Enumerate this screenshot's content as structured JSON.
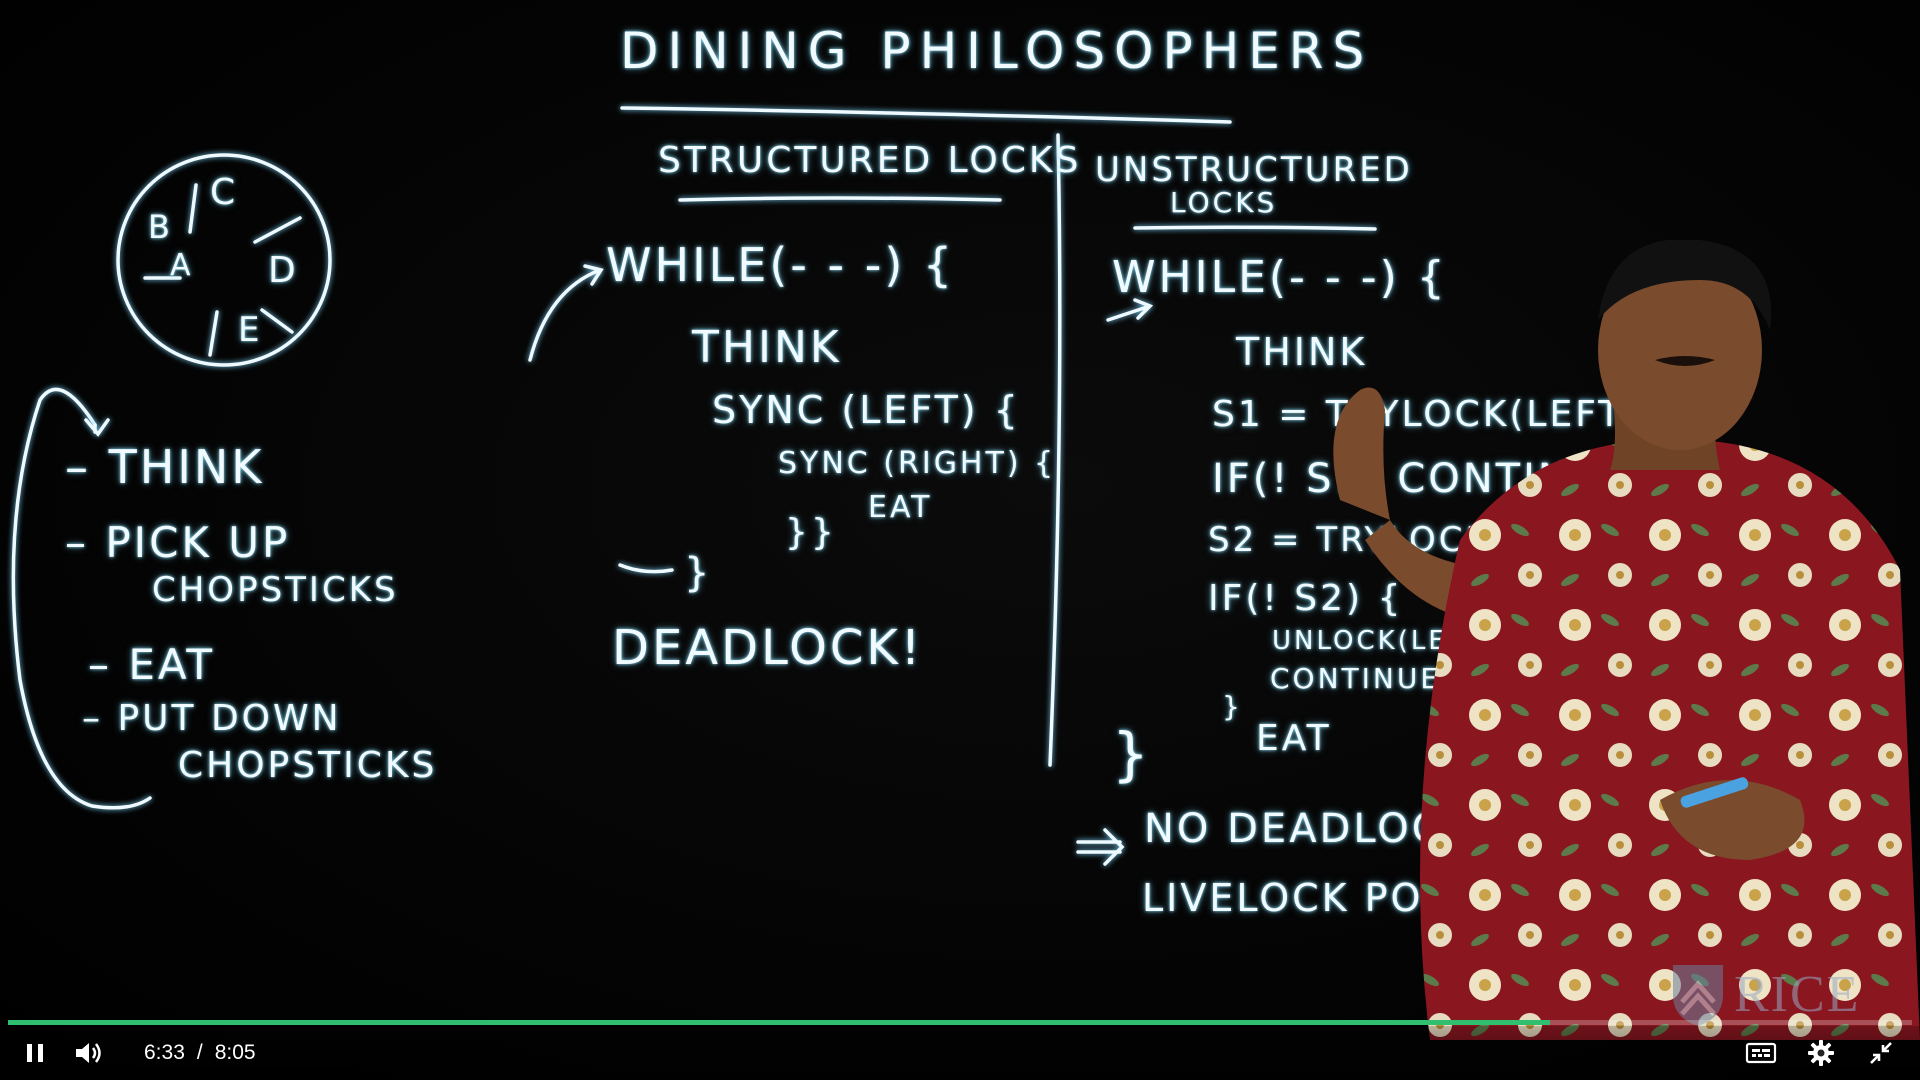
{
  "board": {
    "title": "DINING PHILOSOPHERS",
    "philosophers": [
      "A",
      "B",
      "C",
      "D",
      "E"
    ],
    "steps": [
      "THINK",
      "PICK UP",
      "CHOPSTICKS",
      "EAT",
      "PUT DOWN",
      "CHOPSTICKS"
    ],
    "structured": {
      "heading": "STRUCTURED LOCKS",
      "lines": [
        "WHILE(- - -) {",
        "THINK",
        "SYNC (LEFT) {",
        "SYNC (RIGHT) {",
        "EAT",
        "}}",
        "}"
      ],
      "result": "DEADLOCK!"
    },
    "unstructured": {
      "heading_line1": "UNSTRUCTURED",
      "heading_line2": "LOCKS",
      "lines": [
        "WHILE(- - -) {",
        "THINK",
        "S1 = TRYLOCK(LEFT)",
        "IF(! S1) CONTINUE;",
        "S2 = TRYLOCK(RIGHT)",
        "IF(! S2) {",
        "UNLOCK(LEFT)",
        "CONTINUE;",
        "}",
        "EAT",
        "}"
      ],
      "result_line1": "NO DEADLOCK",
      "result_line2": "LIVELOCK POSSIBLE"
    },
    "watermark": "RICE"
  },
  "player": {
    "current_time": "6:33",
    "separator": "/",
    "duration": "8:05",
    "progress_fraction": 0.81,
    "accent_color": "#2fbf6f",
    "buttons": {
      "play_pause": "pause-icon",
      "volume": "volume-icon",
      "captions": "captions-icon",
      "settings": "gear-icon",
      "fullscreen": "exit-fullscreen-icon"
    }
  }
}
